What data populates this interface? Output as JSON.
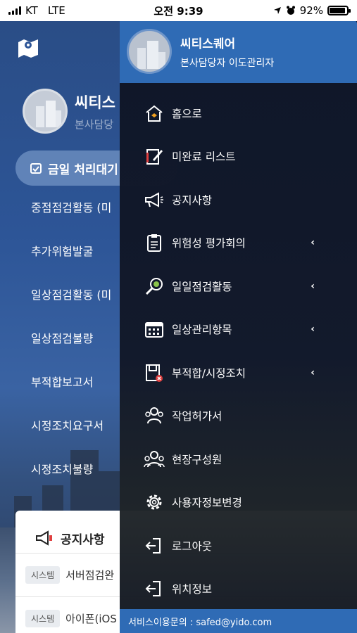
{
  "status_bar": {
    "carrier": "KT",
    "network": "LTE",
    "time": "오전 9:39",
    "battery_text": "92%",
    "battery_level": 0.92
  },
  "background_app": {
    "profile": {
      "name": "씨티스",
      "role": "본사담당"
    },
    "today_button": "금일 처리대기",
    "list": [
      {
        "label": "중점점검활동 (미"
      },
      {
        "label": "추가위험발굴"
      },
      {
        "label": "일상점검활동 (미"
      },
      {
        "label": "일상점검불량"
      },
      {
        "label": "부적합보고서"
      },
      {
        "label": "시정조치요구서"
      },
      {
        "label": "시정조치불량"
      }
    ],
    "notice": {
      "title": "공지사항",
      "rows": [
        {
          "tag": "시스템",
          "text": "서버점검완"
        },
        {
          "tag": "시스템",
          "text": "아이폰(iOS"
        }
      ]
    }
  },
  "drawer": {
    "profile": {
      "name": "씨티스퀘어",
      "role": "본사담당자 이도관리자"
    },
    "menu": [
      {
        "label": "홈으로",
        "icon": "home-icon",
        "has_submenu": false
      },
      {
        "label": "미완료 리스트",
        "icon": "pencil-note-icon",
        "has_submenu": false
      },
      {
        "label": "공지사항",
        "icon": "megaphone-icon",
        "has_submenu": false
      },
      {
        "label": "위험성 평가회의",
        "icon": "clipboard-icon",
        "has_submenu": true
      },
      {
        "label": "일일점검활동",
        "icon": "magnifier-icon",
        "has_submenu": true
      },
      {
        "label": "일상관리항목",
        "icon": "calendar-icon",
        "has_submenu": true
      },
      {
        "label": "부적합/시정조치",
        "icon": "document-alert-icon",
        "has_submenu": true
      },
      {
        "label": "작업허가서",
        "icon": "group-icon",
        "has_submenu": false
      },
      {
        "label": "현장구성원",
        "icon": "team-icon",
        "has_submenu": false
      },
      {
        "label": "사용자정보변경",
        "icon": "gear-icon",
        "has_submenu": false
      },
      {
        "label": "로그아웃",
        "icon": "logout-icon",
        "has_submenu": false
      },
      {
        "label": "위치정보",
        "icon": "location-exit-icon",
        "has_submenu": false
      }
    ],
    "chevron": "‹",
    "footer": "서비스이용문의 : safed@yido.com"
  },
  "colors": {
    "drawer_header": "#2f6bb5",
    "drawer_body": "#10162a",
    "accent_orange": "#f0a020",
    "accent_green": "#8bc34a",
    "accent_red": "#e04040"
  }
}
